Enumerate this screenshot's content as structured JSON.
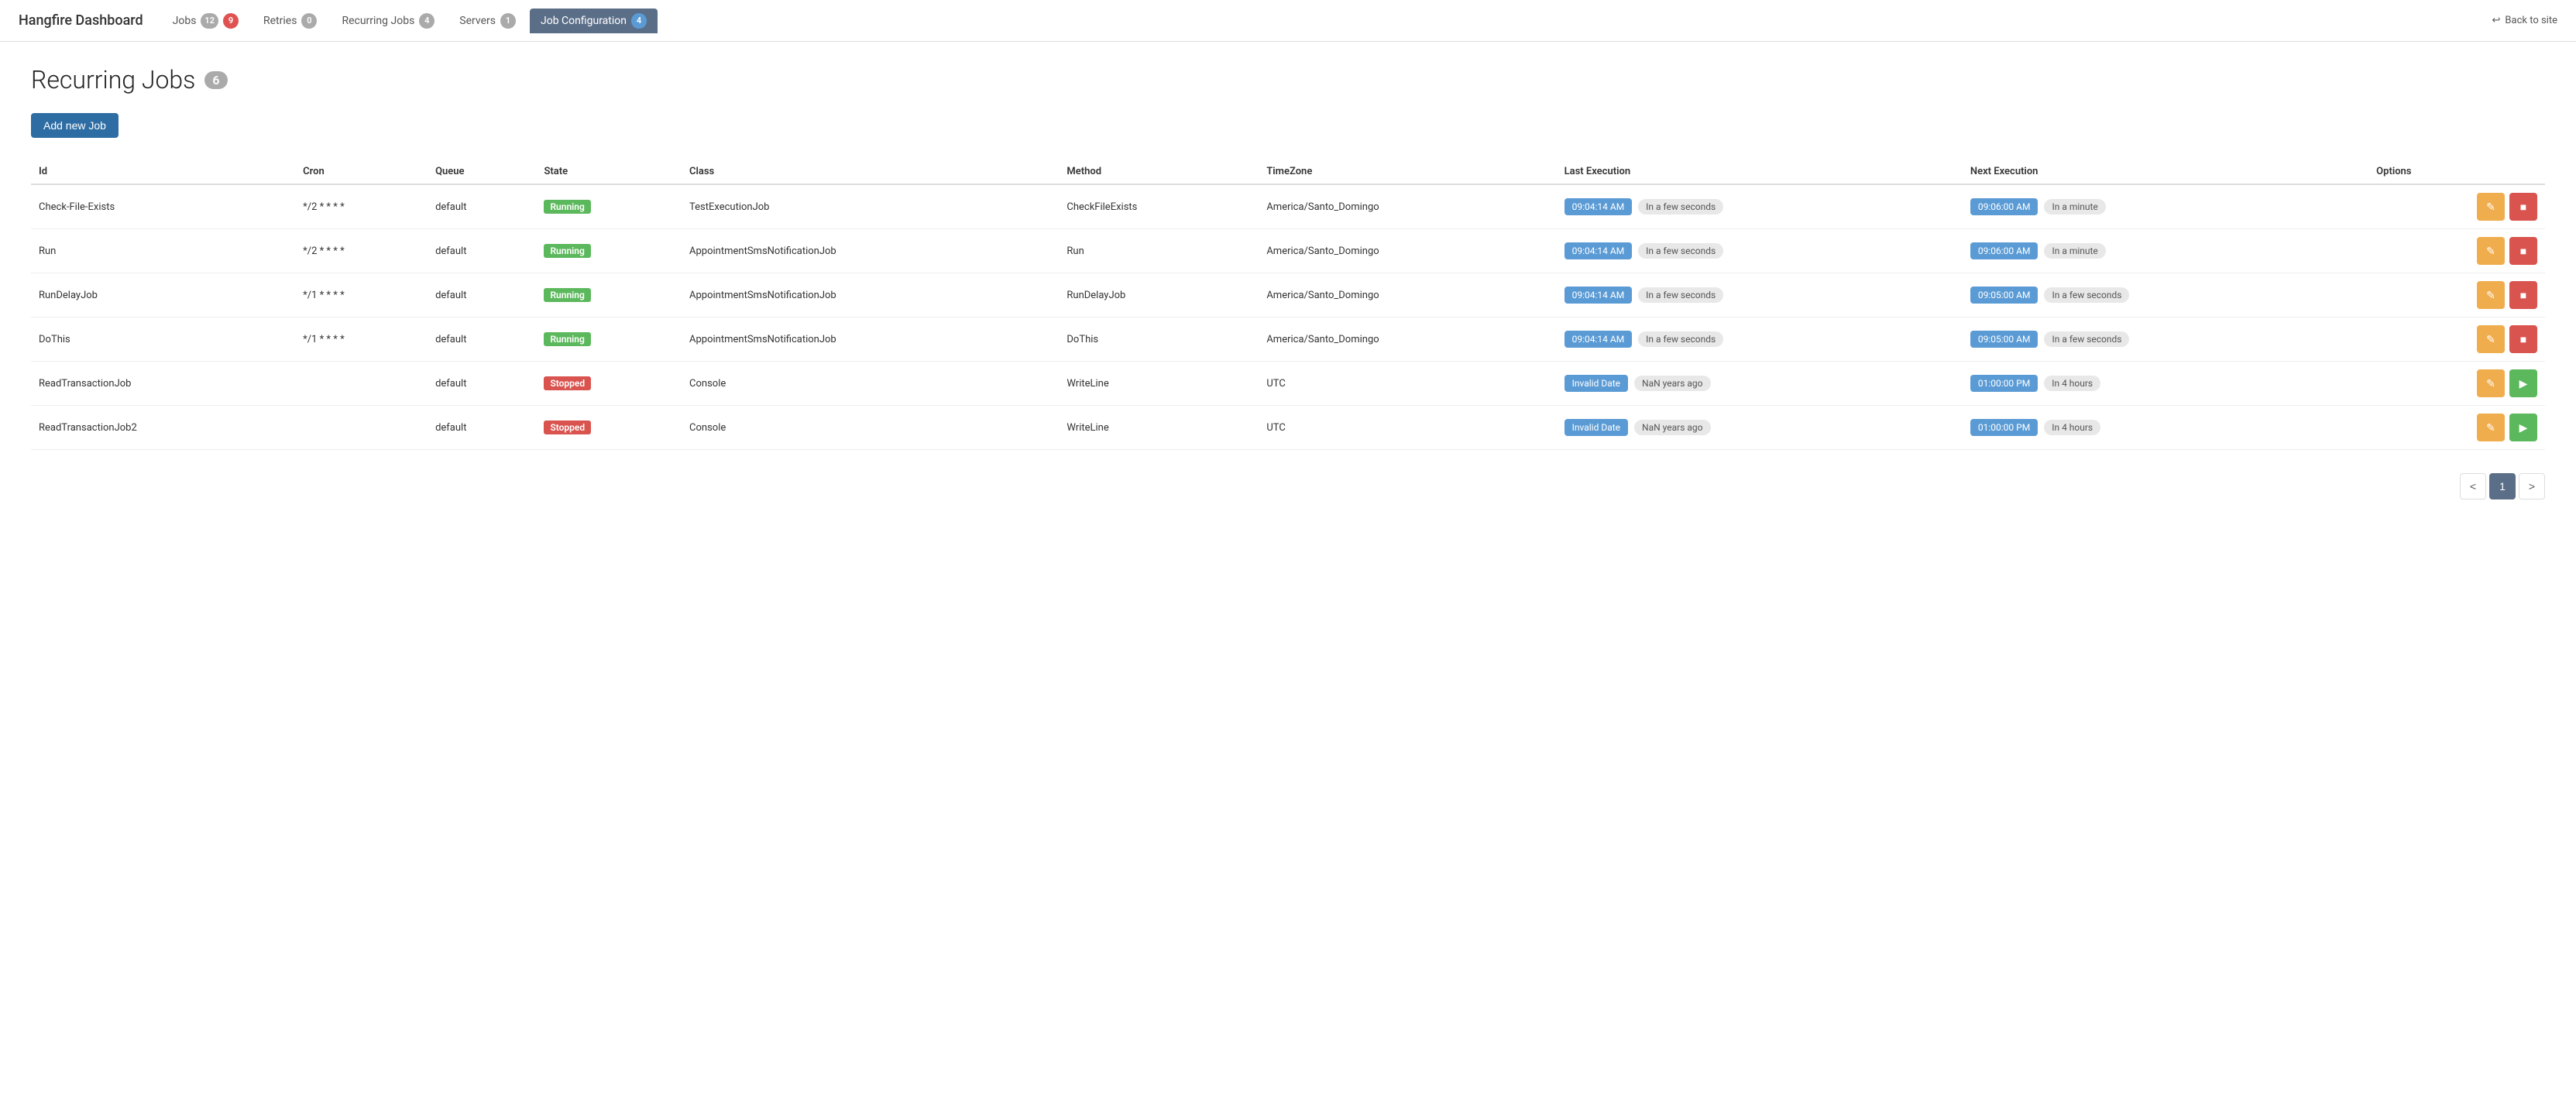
{
  "navbar": {
    "brand": "Hangfire Dashboard",
    "back_label": "Back to site",
    "nav_items": [
      {
        "id": "jobs",
        "label": "Jobs",
        "badge": "12",
        "badge2": "9",
        "badge2_type": "danger",
        "badge_type": "default",
        "active": false
      },
      {
        "id": "retries",
        "label": "Retries",
        "badge": "0",
        "badge_type": "default",
        "active": false
      },
      {
        "id": "recurring",
        "label": "Recurring Jobs",
        "badge": "4",
        "badge_type": "default",
        "active": false
      },
      {
        "id": "servers",
        "label": "Servers",
        "badge": "1",
        "badge_type": "default",
        "active": false
      },
      {
        "id": "jobconfig",
        "label": "Job Configuration",
        "badge": "4",
        "badge_type": "default",
        "active": true
      }
    ]
  },
  "page": {
    "title": "Recurring Jobs",
    "count": "6",
    "add_button": "Add new Job"
  },
  "table": {
    "columns": [
      "Id",
      "Cron",
      "Queue",
      "State",
      "Class",
      "Method",
      "TimeZone",
      "Last Execution",
      "Next Execution",
      "Options"
    ],
    "rows": [
      {
        "id": "Check-File-Exists",
        "cron": "*/2 * * * *",
        "queue": "default",
        "state": "Running",
        "state_type": "running",
        "class": "TestExecutionJob",
        "method": "CheckFileExists",
        "timezone": "America/Santo_Domingo",
        "last_time": "09:04:14 AM",
        "last_rel": "In a few seconds",
        "next_time": "09:06:00 AM",
        "next_rel": "In a minute",
        "has_delete": true,
        "has_run": false
      },
      {
        "id": "Run",
        "cron": "*/2 * * * *",
        "queue": "default",
        "state": "Running",
        "state_type": "running",
        "class": "AppointmentSmsNotificationJob",
        "method": "Run",
        "timezone": "America/Santo_Domingo",
        "last_time": "09:04:14 AM",
        "last_rel": "In a few seconds",
        "next_time": "09:06:00 AM",
        "next_rel": "In a minute",
        "has_delete": true,
        "has_run": false
      },
      {
        "id": "RunDelayJob",
        "cron": "*/1 * * * *",
        "queue": "default",
        "state": "Running",
        "state_type": "running",
        "class": "AppointmentSmsNotificationJob",
        "method": "RunDelayJob",
        "timezone": "America/Santo_Domingo",
        "last_time": "09:04:14 AM",
        "last_rel": "In a few seconds",
        "next_time": "09:05:00 AM",
        "next_rel": "In a few seconds",
        "has_delete": true,
        "has_run": false
      },
      {
        "id": "DoThis",
        "cron": "*/1 * * * *",
        "queue": "default",
        "state": "Running",
        "state_type": "running",
        "class": "AppointmentSmsNotificationJob",
        "method": "DoThis",
        "timezone": "America/Santo_Domingo",
        "last_time": "09:04:14 AM",
        "last_rel": "In a few seconds",
        "next_time": "09:05:00 AM",
        "next_rel": "In a few seconds",
        "has_delete": true,
        "has_run": false
      },
      {
        "id": "ReadTransactionJob",
        "cron": "",
        "queue": "default",
        "state": "Stopped",
        "state_type": "stopped",
        "class": "Console",
        "method": "WriteLine",
        "timezone": "UTC",
        "last_time": "Invalid Date",
        "last_rel": "NaN years ago",
        "next_time": "01:00:00 PM",
        "next_rel": "In 4 hours",
        "has_delete": true,
        "has_run": true
      },
      {
        "id": "ReadTransactionJob2",
        "cron": "",
        "queue": "default",
        "state": "Stopped",
        "state_type": "stopped",
        "class": "Console",
        "method": "WriteLine",
        "timezone": "UTC",
        "last_time": "Invalid Date",
        "last_rel": "NaN years ago",
        "next_time": "01:00:00 PM",
        "next_rel": "In 4 hours",
        "has_delete": true,
        "has_run": true
      }
    ]
  },
  "pagination": {
    "prev": "<",
    "current": "1",
    "next": ">"
  },
  "icons": {
    "back": "↩",
    "edit": "✎",
    "delete": "■",
    "run": "▶"
  }
}
